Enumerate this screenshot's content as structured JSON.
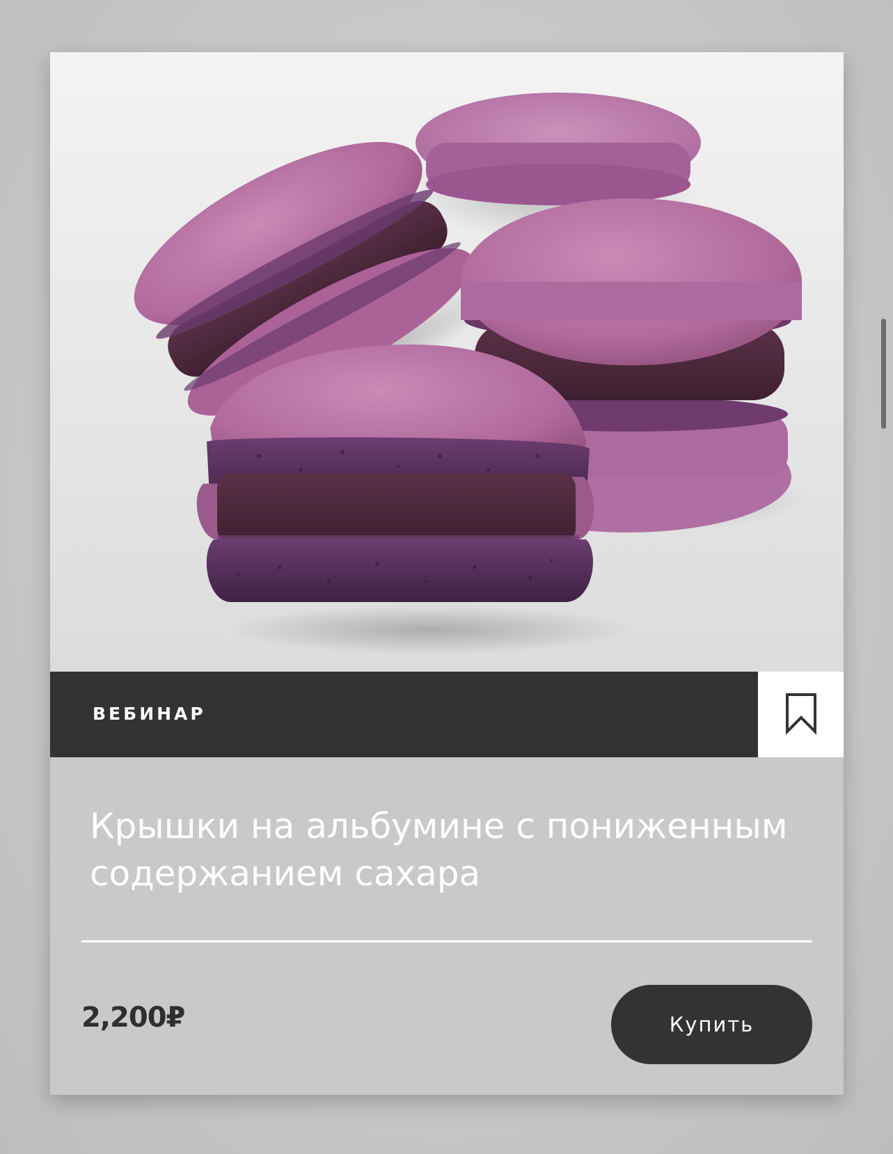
{
  "card": {
    "image_alt": "macarons",
    "tag": "ВЕБИНАР",
    "title": "Крышки на альбумине с пониженным содержанием сахара",
    "price": "2,200₽",
    "buy_label": "Купить"
  },
  "icons": {
    "bookmark": "bookmark-icon"
  },
  "colors": {
    "dark": "#333333",
    "card_bg": "#c9c9c9",
    "macaron_shell": "#b0679c",
    "macaron_filling": "#4e2a3d",
    "macaron_crumb": "#5a2f5d"
  }
}
